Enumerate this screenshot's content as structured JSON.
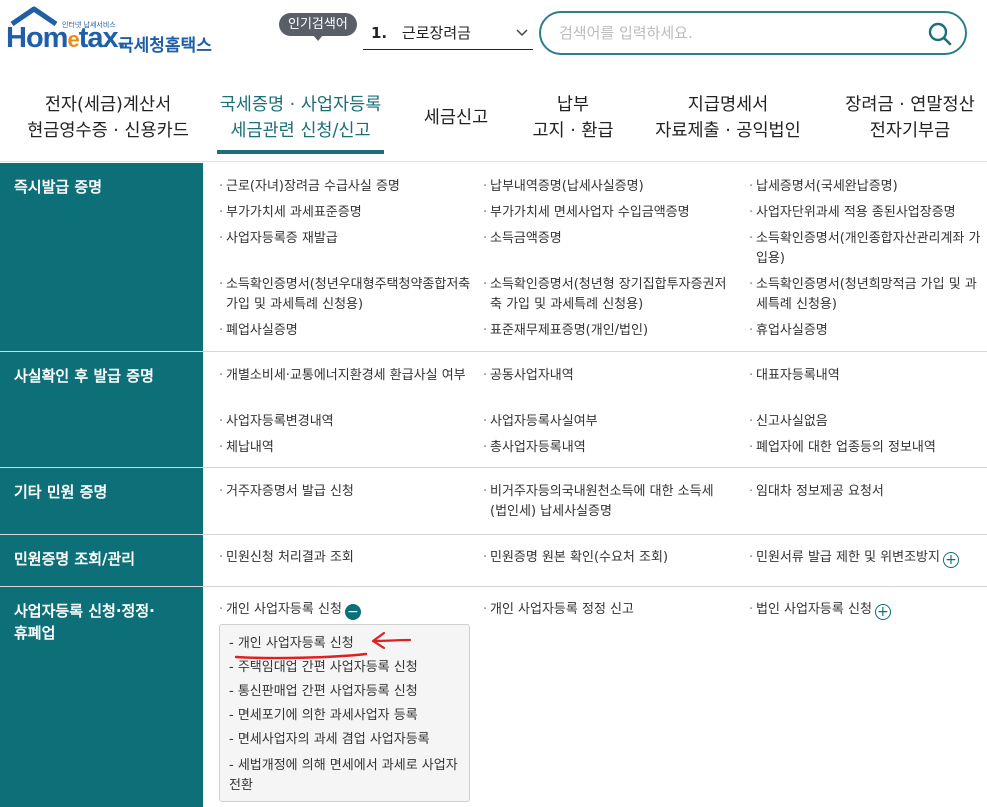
{
  "brand": {
    "tagline": "인터넷 납세서비스",
    "home": "Hom",
    "e": "e",
    "tax": "tax.",
    "korean": "국세청홈택스"
  },
  "search": {
    "popular_badge": "인기검색어",
    "popular_num": "1.",
    "popular_value": "근로장려금",
    "placeholder": "검색어를 입력하세요."
  },
  "nav": [
    {
      "line1": "전자(세금)계산서",
      "line2": "현금영수증 · 신용카드"
    },
    {
      "line1": "국세증명 · 사업자등록",
      "line2": "세금관련 신청/신고"
    },
    {
      "line1": "세금신고",
      "line2": ""
    },
    {
      "line1": "납부",
      "line2": "고지 · 환급"
    },
    {
      "line1": "지급명세서",
      "line2": "자료제출 · 공익법인"
    },
    {
      "line1": "장려금 · 연말정산",
      "line2": "전자기부금"
    }
  ],
  "sections": [
    {
      "title": "즉시발급 증명",
      "items": [
        "근로(자녀)장려금 수급사실 증명",
        "납부내역증명(납세사실증명)",
        "납세증명서(국세완납증명)",
        "부가가치세 과세표준증명",
        "부가가치세 면세사업자 수입금액증명",
        "사업자단위과세 적용 종된사업장증명",
        "사업자등록증 재발급",
        "소득금액증명",
        "소득확인증명서(개인종합자산관리계좌 가입용)",
        "소득확인증명서(청년우대형주택청약종합저축 가입 및 과세특례 신청용)",
        "소득확인증명서(청년형 장기집합투자증권저축 가입 및 과세특례 신청용)",
        "소득확인증명서(청년희망적금 가입 및 과세특례 신청용)",
        "폐업사실증명",
        "표준재무제표증명(개인/법인)",
        "휴업사실증명"
      ]
    },
    {
      "title": "사실확인 후 발급 증명",
      "items": [
        "개별소비세·교통에너지환경세 환급사실 여부",
        "공동사업자내역",
        "대표자등록내역",
        "사업자등록변경내역",
        "사업자등록사실여부",
        "신고사실없음",
        "체납내역",
        "총사업자등록내역",
        "폐업자에 대한 업종등의 정보내역"
      ]
    },
    {
      "title": "기타 민원 증명",
      "items": [
        "거주자증명서 발급 신청",
        "비거주자등의국내원천소득에 대한 소득세(법인세) 납세사실증명",
        "임대차 정보제공 요청서"
      ]
    },
    {
      "title": "민원증명 조회/관리",
      "items": [
        "민원신청 처리결과 조회",
        "민원증명 원본 확인(수요처 조회)",
        "민원서류 발급 제한 및 위변조방지"
      ]
    },
    {
      "title": "사업자등록 신청·정정·휴폐업",
      "items": [
        "개인 사업자등록 신청",
        "개인 사업자등록 정정 신고",
        "법인 사업자등록 신청"
      ]
    }
  ],
  "submenu": [
    "- 개인 사업자등록 신청",
    "- 주택임대업 간편 사업자등록 신청",
    "- 통신판매업 간편 사업자등록 신청",
    "- 면세포기에 의한 과세사업자 등록",
    "- 면세사업자의 과세 겸업 사업자등록",
    "- 세법개정에 의해 면세에서 과세로 사업자 전환"
  ],
  "colors": {
    "accent": "#0d6f77",
    "brand_blue": "#1e5fa8",
    "annotation": "#e02020"
  }
}
